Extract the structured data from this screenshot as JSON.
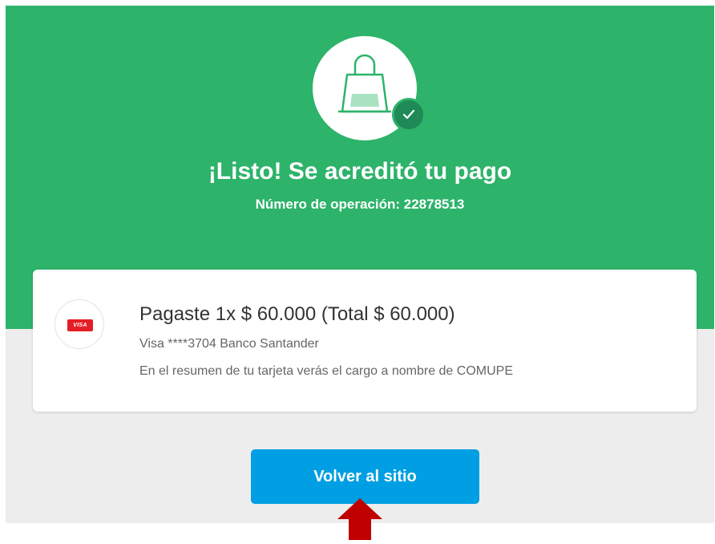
{
  "colors": {
    "accent": "#2db36a",
    "button": "#009ee3",
    "arrow": "#c00000"
  },
  "header": {
    "icon": "shopping-bag-icon",
    "badge_icon": "check-icon",
    "title": "¡Listo! Se acreditó tu pago",
    "operation": "Número de operación: 22878513"
  },
  "payment": {
    "card_logo": "VISA",
    "summary": "Pagaste 1x $ 60.000 (Total $ 60.000)",
    "card_info": "Visa ****3704 Banco Santander",
    "statement_note": "En el resumen de tu tarjeta verás el cargo a nombre de COMUPE"
  },
  "actions": {
    "back_label": "Volver al sitio"
  },
  "annotation": {
    "icon": "arrow-up-icon"
  }
}
